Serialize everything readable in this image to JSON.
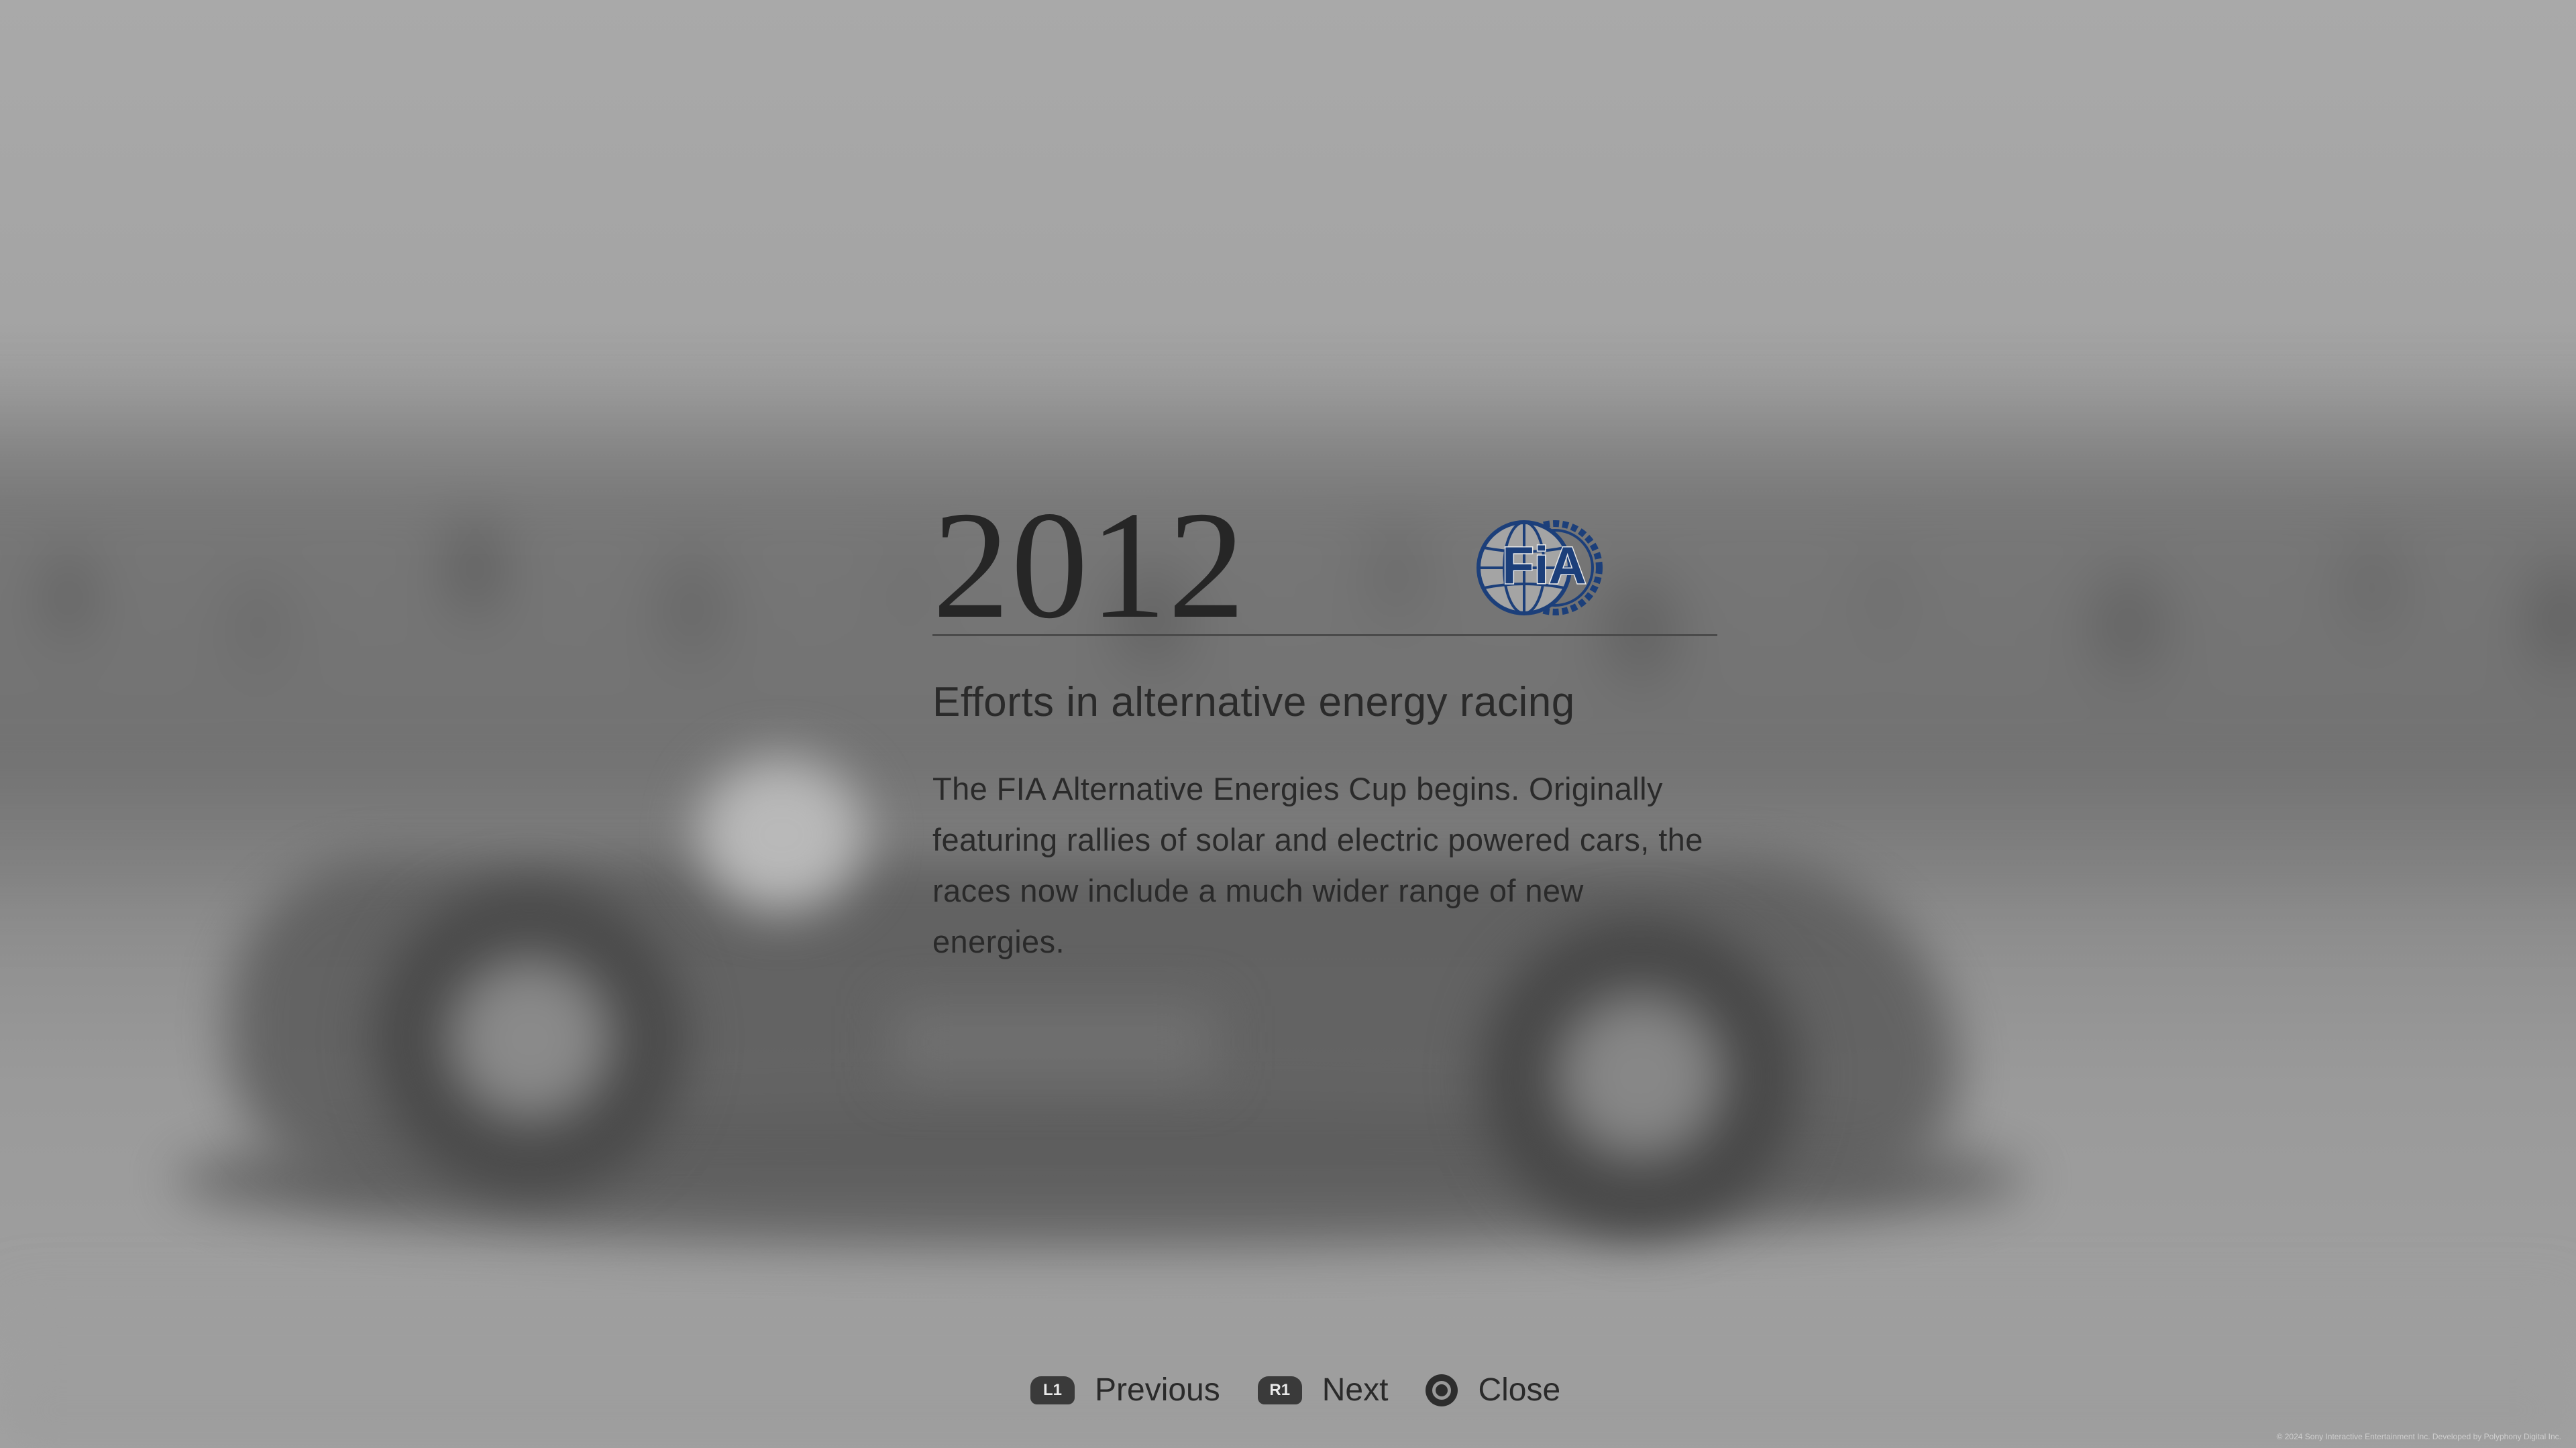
{
  "event": {
    "year": "2012",
    "logo_icon": "fia-logo-icon",
    "logo_text": "FiA",
    "logo_color": "#1c3f7a",
    "title": "Efforts in alternative energy racing",
    "body": "The FIA Alternative Energies Cup begins. Originally featuring rallies of solar and electric powered cars, the races now include a much wider range of new energies."
  },
  "controls": {
    "previous": {
      "badge": "L1",
      "label": "Previous"
    },
    "next": {
      "badge": "R1",
      "label": "Next"
    },
    "close": {
      "icon": "circle-button-icon",
      "label": "Close"
    }
  },
  "footer": {
    "copyright": "© 2024 Sony Interactive Entertainment Inc. Developed by Polyphony Digital Inc."
  }
}
